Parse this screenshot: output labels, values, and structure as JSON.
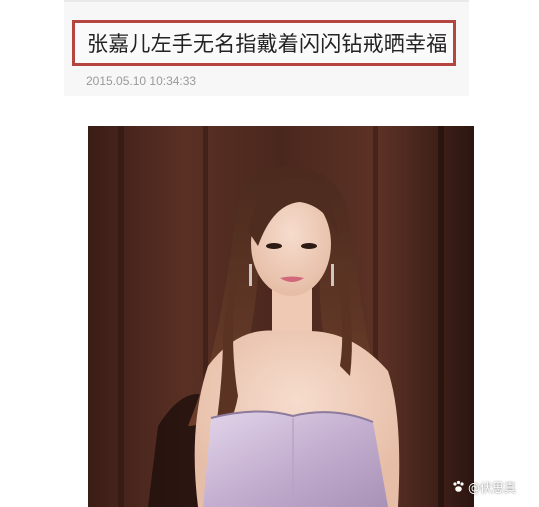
{
  "article": {
    "title": "张嘉儿左手无名指戴着闪闪钻戒晒幸福",
    "timestamp": "2015.05.10 10:34:33"
  },
  "image": {
    "subject": "woman-in-lavender-strapless-dress",
    "watermark_icon": "paw-icon",
    "watermark_text": "@伏思真"
  },
  "colors": {
    "title_border": "#b5463f",
    "title_text": "#222222",
    "timestamp_text": "#999999",
    "photo_background": "#2a1410",
    "dress": "#c9b6d3"
  }
}
